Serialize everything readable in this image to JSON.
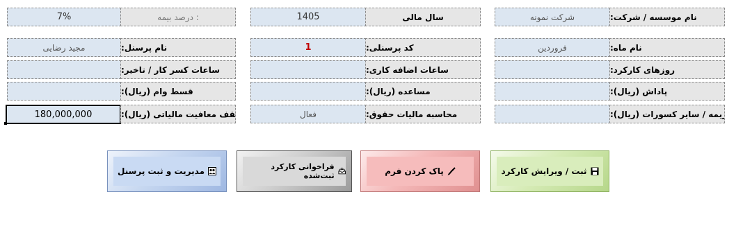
{
  "top_row": {
    "insurance_percent": {
      "value": "7%",
      "label": "درصد بیمه :"
    },
    "fiscal_year": {
      "value": "1405",
      "label": "سال مالی"
    },
    "company": {
      "value": "شرکت نمونه",
      "label": "نام موسسه / شرکت:"
    }
  },
  "fields": {
    "personnel_name": {
      "label": "نام پرسنل:",
      "value": "مجید رضایی"
    },
    "personnel_code": {
      "label": "کد پرسنلی:",
      "value": "1"
    },
    "month_name": {
      "label": "نام ماه:",
      "value": "فروردین"
    },
    "absence_hours": {
      "label": "ساعات کسر کار / تاخیر:",
      "value": ""
    },
    "overtime_hours": {
      "label": "ساعات اضافه کاری:",
      "value": ""
    },
    "working_days": {
      "label": "روزهای کارکرد:",
      "value": ""
    },
    "loan_installment": {
      "label": "قسط وام (ریال):",
      "value": ""
    },
    "assistance": {
      "label": "مساعده (ریال):",
      "value": ""
    },
    "bonus": {
      "label": "پاداش (ریال):",
      "value": ""
    },
    "tax_exemption_cap": {
      "label": "سقف معافیت مالیاتی (ریال):",
      "value": "180,000,000"
    },
    "salary_tax_calc": {
      "label": "محاسبه مالیات حقوق:",
      "value": "فعال"
    },
    "penalty_deductions": {
      "label": "جریمه / سایر کسورات (ریال):",
      "value": ""
    }
  },
  "buttons": {
    "manage_personnel": {
      "label": "مدیریت و ثبت پرسنل",
      "icon": "people-icon",
      "color": "#c6d7f0"
    },
    "load_records": {
      "label": "فراخوانی کارکرد ثبت‌شده",
      "icon": "inbox-icon",
      "color": "#d9d9d9"
    },
    "clear_form": {
      "label": "پاک کردن فرم",
      "icon": "brush-icon",
      "color": "#f6bcbc"
    },
    "save_edit": {
      "label": "ثبت / ویرایش کارکرد",
      "icon": "floppy-icon",
      "color": "#d9edbc"
    }
  }
}
